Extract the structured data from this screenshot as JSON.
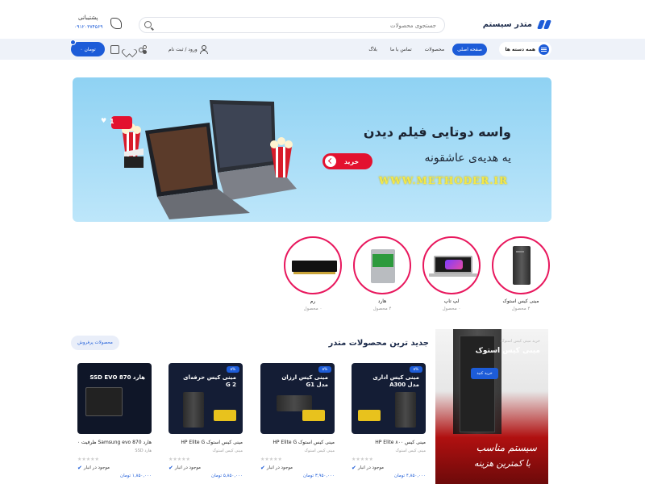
{
  "header": {
    "logo_text": "متدر سیستم",
    "search_placeholder": "جستجوی محصولات",
    "support_title": "پشتیبانی",
    "support_phone": "۰۹۱۲۰۳۷۴۵۶۹"
  },
  "nav": {
    "categories_label": "همه دسته ها",
    "links": [
      "صفحه اصلی",
      "محصولات",
      "تماس با ما",
      "بلاگ"
    ],
    "login_label": "ورود / ثبت نام",
    "cart_label": "۰ تومان"
  },
  "banner": {
    "headline": "واسه دوتایی فیلم دیدن",
    "subline": "یه هدیه‌ی عاشقونه",
    "buy_label": "خرید",
    "url": "WWW.METHODER.IR",
    "like_count": "1"
  },
  "categories": [
    {
      "name": "مینی کیس استوک",
      "count": "۴ محصول"
    },
    {
      "name": "لپ تاپ",
      "count": "۰ محصول"
    },
    {
      "name": "هارد",
      "count": "۴ محصول"
    },
    {
      "name": "رم",
      "count": "۰ محصول"
    }
  ],
  "products_section": {
    "title": "جدید ترین محصولات متدر",
    "best_sellers_label": "محصولات پرفروش"
  },
  "promo": {
    "small_text": "خرید مینی کیس استوک",
    "title": "مینی کیس استوک",
    "button_label": "خرید کنید",
    "foot_line1": "سیستم مناسب",
    "foot_line2": "با کمترین هزینه"
  },
  "products": [
    {
      "tag": "۵%",
      "thumb_title": "مینی کیس اداری مدل A300",
      "name": "مینی کیس HP Elite ۸۰۰",
      "category": "مینی کیس استوک",
      "stock": "موجود در انبار",
      "price": "۴,۸۵۰,۰۰۰ تومان"
    },
    {
      "tag": "۵%",
      "thumb_title": "مینی کیس ارزان مدل G1",
      "name": "مینی کیس استوک HP Elite G",
      "category": "مینی کیس استوک",
      "stock": "موجود در انبار",
      "price": "۳,۹۵۰,۰۰۰ تومان"
    },
    {
      "tag": "۵%",
      "thumb_title": "مینی کیس حرفه‌ای G 2",
      "name": "مینی کیس استوک HP Elite G",
      "category": "مینی کیس استوک",
      "stock": "موجود در انبار",
      "price": "۵,۸۵۰,۰۰۰ تومان"
    },
    {
      "tag": "",
      "thumb_title": "هارد SSD EVO 870",
      "name": "هارد Samsung evo 870 ظرفیت ۲۵۰",
      "category": "هارد SSD",
      "stock": "موجود در انبار",
      "price": "۱,۸۵۰,۰۰۰ تومان"
    }
  ],
  "colors": {
    "brand": "#1d5cd8",
    "category_ring": "#e8175d",
    "banner_bg": "#9fd8f5",
    "buy_button": "#e3112f"
  }
}
